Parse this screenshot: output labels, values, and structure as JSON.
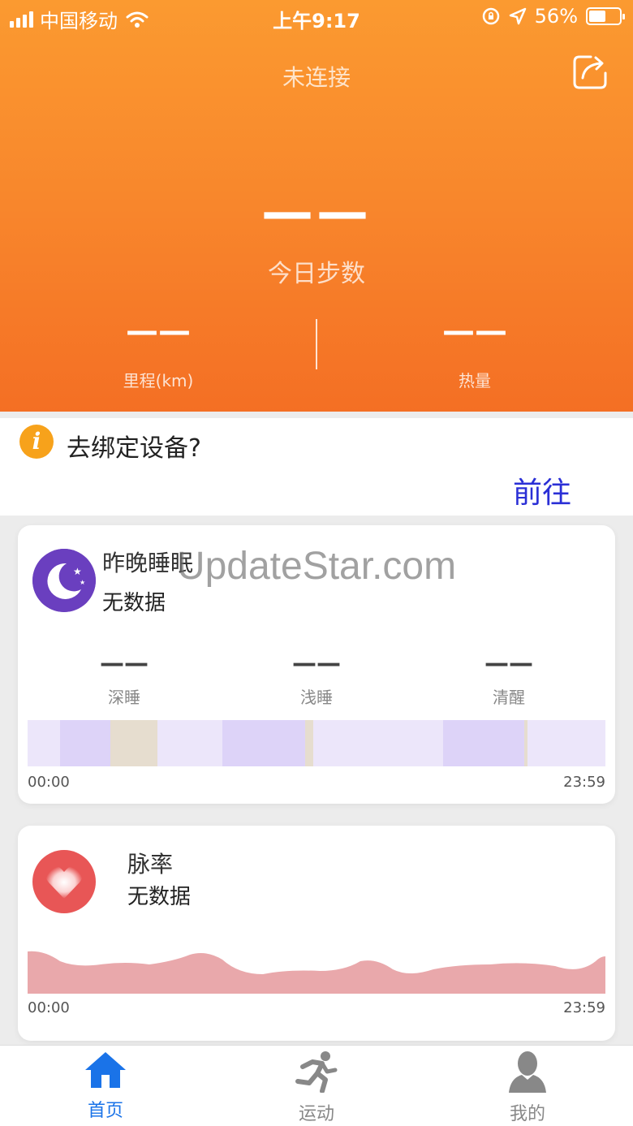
{
  "status_bar": {
    "carrier": "中国移动",
    "time": "上午9:17",
    "battery": "56%",
    "battery_level": 0.56
  },
  "header": {
    "title": "未连接",
    "steps_value": "——",
    "steps_label": "今日步数",
    "distance_value": "——",
    "distance_label": "里程(km)",
    "calories_value": "——",
    "calories_label": "热量"
  },
  "bind_device": {
    "text": "去绑定设备?",
    "action": "前往"
  },
  "sleep": {
    "title": "昨晚睡眠",
    "subtitle": "无数据",
    "deep_value": "——",
    "deep_label": "深睡",
    "light_value": "——",
    "light_label": "浅睡",
    "awake_value": "——",
    "awake_label": "清醒",
    "start_time": "00:00",
    "end_time": "23:59"
  },
  "pulse": {
    "title": "脉率",
    "subtitle": "无数据",
    "start_time": "00:00",
    "end_time": "23:59"
  },
  "watermark": "UpdateStar.com",
  "tabs": [
    {
      "label": "首页",
      "icon": "home-icon",
      "active": true
    },
    {
      "label": "运动",
      "icon": "running-icon",
      "active": false
    },
    {
      "label": "我的",
      "icon": "profile-icon",
      "active": false
    }
  ],
  "colors": {
    "header_top": "#fb9a30",
    "header_bottom": "#f46f24",
    "accent_blue": "#1a73e8",
    "link_blue": "#2a2fd6",
    "sleep_purple": "#6a3fbf",
    "pulse_red": "#e85656"
  }
}
